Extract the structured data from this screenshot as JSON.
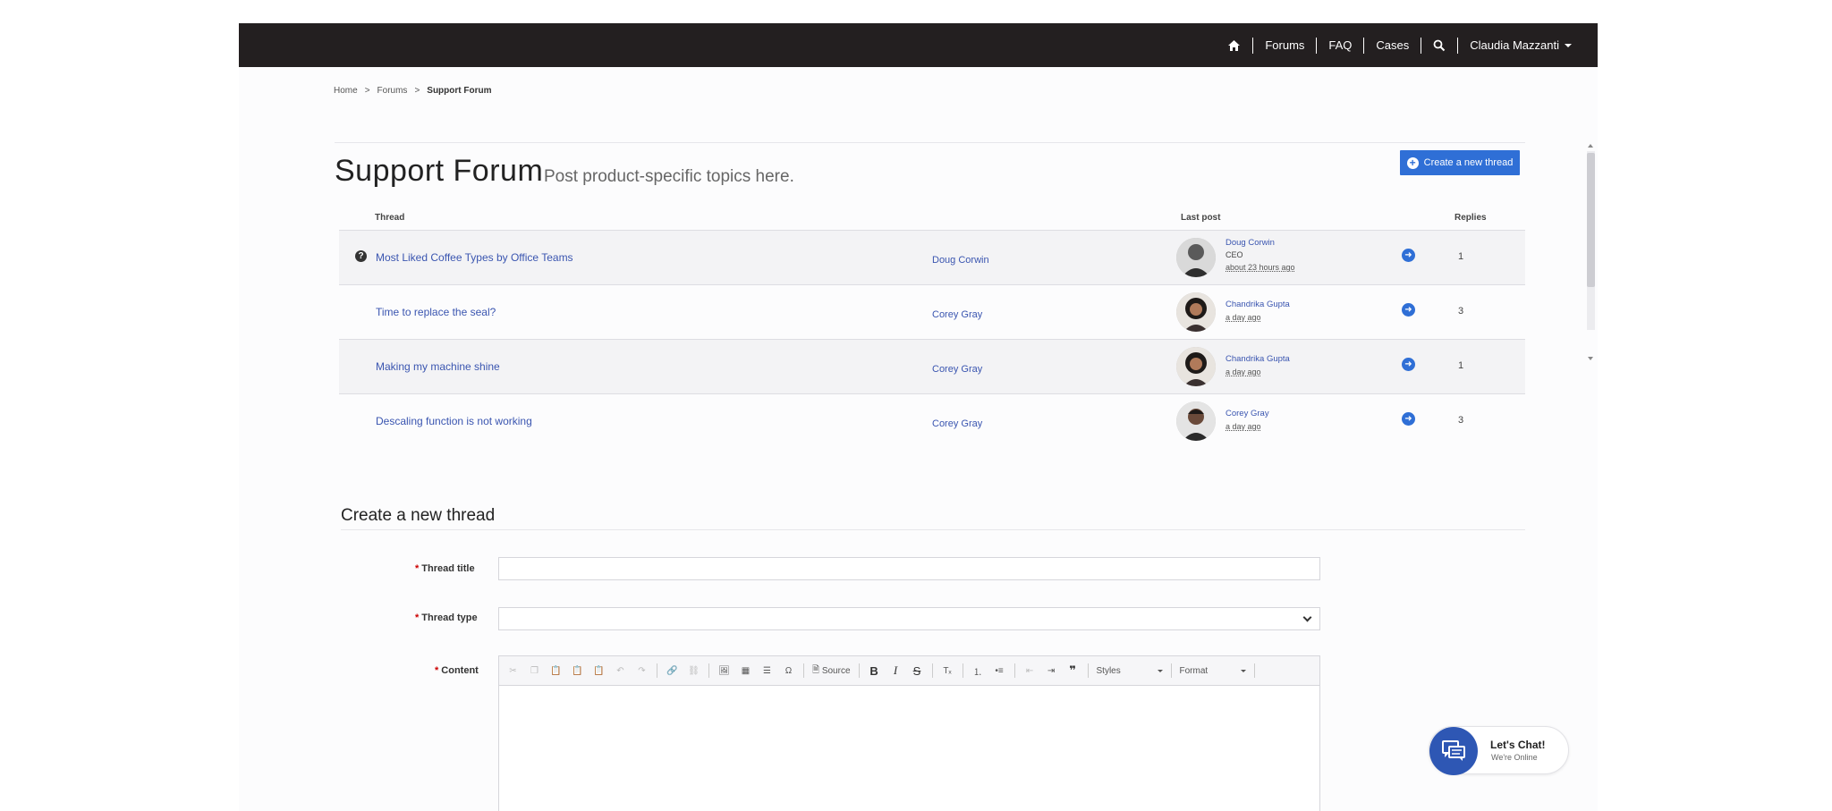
{
  "nav": {
    "home_icon": "home-icon",
    "items": [
      "Forums",
      "FAQ",
      "Cases"
    ],
    "search_icon": "search-icon",
    "user_name": "Claudia Mazzanti"
  },
  "breadcrumb": [
    "Home",
    "Forums",
    "Support Forum"
  ],
  "page": {
    "title": "Support Forum",
    "subtitle": "Post product-specific topics here.",
    "create_button": "Create a new thread"
  },
  "table": {
    "headers": {
      "thread": "Thread",
      "last_post": "Last post",
      "replies": "Replies"
    },
    "rows": [
      {
        "title": "Most Liked Coffee Types by Office Teams",
        "author": "Doug Corwin",
        "lp_name": "Doug Corwin",
        "lp_role": "CEO",
        "lp_time": "about 23 hours ago",
        "replies": "1",
        "question_icon": true
      },
      {
        "title": "Time to replace the seal?",
        "author": "Corey Gray",
        "lp_name": "Chandrika Gupta",
        "lp_role": "",
        "lp_time": "a day ago",
        "replies": "3",
        "question_icon": false
      },
      {
        "title": "Making my machine shine",
        "author": "Corey Gray",
        "lp_name": "Chandrika Gupta",
        "lp_role": "",
        "lp_time": "a day ago",
        "replies": "1",
        "question_icon": false
      },
      {
        "title": "Descaling function is not working",
        "author": "Corey Gray",
        "lp_name": "Corey Gray",
        "lp_role": "",
        "lp_time": "a day ago",
        "replies": "3",
        "question_icon": false
      }
    ]
  },
  "form": {
    "section_title": "Create a new thread",
    "required_mark": "*",
    "thread_title_label": "Thread title",
    "thread_type_label": "Thread type",
    "content_label": "Content",
    "toolbar": {
      "source_label": "Source",
      "styles_label": "Styles",
      "format_label": "Format",
      "bold": "B",
      "italic": "I",
      "strike": "S"
    }
  },
  "chat": {
    "title": "Let's Chat!",
    "subtitle": "We're Online"
  },
  "colors": {
    "nav_bg": "#231f20",
    "accent": "#2f6fd6",
    "link": "#3a55b0",
    "chat": "#2e57b4"
  }
}
